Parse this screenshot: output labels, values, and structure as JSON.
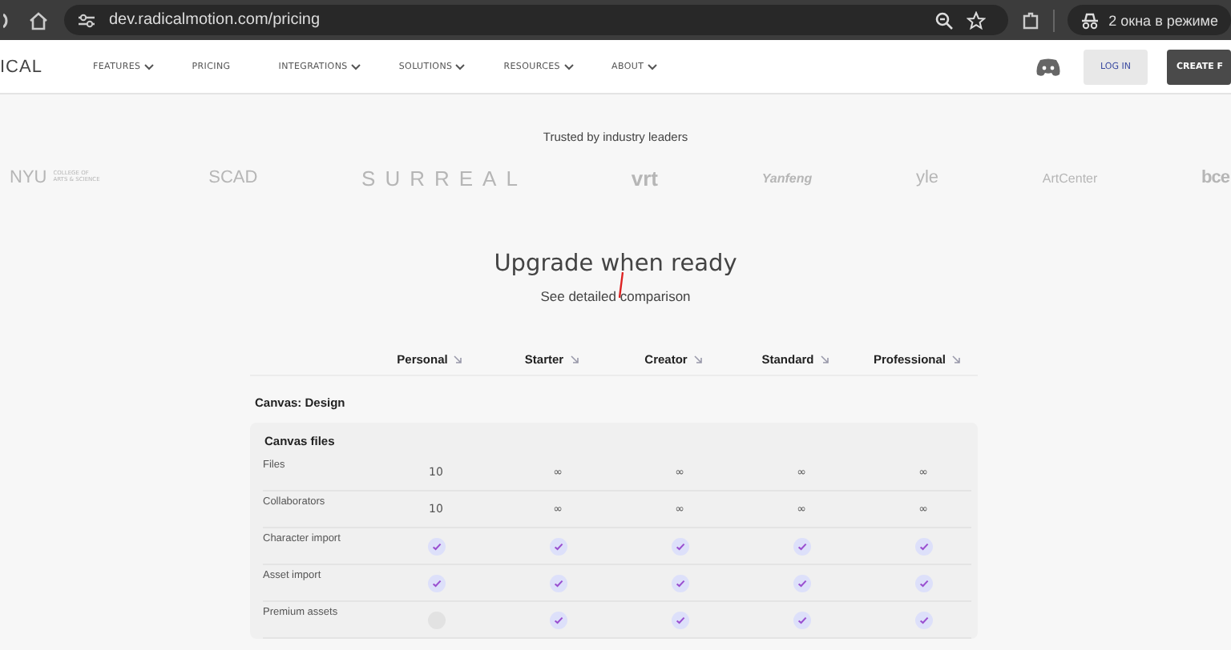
{
  "browser": {
    "url": "dev.radicalmotion.com/pricing",
    "profile": "2 окна в режиме"
  },
  "nav": {
    "logo": "ICAL",
    "items": [
      {
        "label": "FEATURES",
        "dropdown": true
      },
      {
        "label": "PRICING",
        "dropdown": false
      },
      {
        "label": "INTEGRATIONS",
        "dropdown": true
      },
      {
        "label": "SOLUTIONS",
        "dropdown": true
      },
      {
        "label": "RESOURCES",
        "dropdown": true
      },
      {
        "label": "ABOUT",
        "dropdown": true
      }
    ],
    "login": "LOG IN",
    "create": "CREATE F"
  },
  "trusted": {
    "title": "Trusted by industry leaders",
    "logos": [
      {
        "name": "NYU",
        "sub": "COLLEGE OF ARTS & SCIENCE"
      },
      {
        "name": "SCAD"
      },
      {
        "name": "SURREAL"
      },
      {
        "name": "vrt"
      },
      {
        "name": "Yanfeng"
      },
      {
        "name": "yle"
      },
      {
        "name": "ArtCenter"
      },
      {
        "name": "bce"
      }
    ]
  },
  "heading": "Upgrade when ready",
  "subheading": "See detailed comparison",
  "plans": [
    "Personal",
    "Starter",
    "Creator",
    "Standard",
    "Professional"
  ],
  "section": "Canvas: Design",
  "group": "Canvas files",
  "rows": [
    {
      "label": "Files",
      "cells": [
        {
          "kind": "text",
          "text": "10"
        },
        {
          "kind": "text",
          "text": "∞"
        },
        {
          "kind": "text",
          "text": "∞"
        },
        {
          "kind": "text",
          "text": "∞"
        },
        {
          "kind": "text",
          "text": "∞"
        }
      ]
    },
    {
      "label": "Collaborators",
      "cells": [
        {
          "kind": "text",
          "text": "10"
        },
        {
          "kind": "text",
          "text": "∞"
        },
        {
          "kind": "text",
          "text": "∞"
        },
        {
          "kind": "text",
          "text": "∞"
        },
        {
          "kind": "text",
          "text": "∞"
        }
      ]
    },
    {
      "label": "Character import",
      "cells": [
        {
          "kind": "check",
          "checked": true
        },
        {
          "kind": "check",
          "checked": true
        },
        {
          "kind": "check",
          "checked": true
        },
        {
          "kind": "check",
          "checked": true
        },
        {
          "kind": "check",
          "checked": true
        }
      ]
    },
    {
      "label": "Asset import",
      "cells": [
        {
          "kind": "check",
          "checked": true
        },
        {
          "kind": "check",
          "checked": true
        },
        {
          "kind": "check",
          "checked": true
        },
        {
          "kind": "check",
          "checked": true
        },
        {
          "kind": "check",
          "checked": true
        }
      ]
    },
    {
      "label": "Premium assets",
      "cells": [
        {
          "kind": "check",
          "checked": false
        },
        {
          "kind": "check",
          "checked": true
        },
        {
          "kind": "check",
          "checked": true
        },
        {
          "kind": "check",
          "checked": true
        },
        {
          "kind": "check",
          "checked": true
        }
      ]
    }
  ]
}
